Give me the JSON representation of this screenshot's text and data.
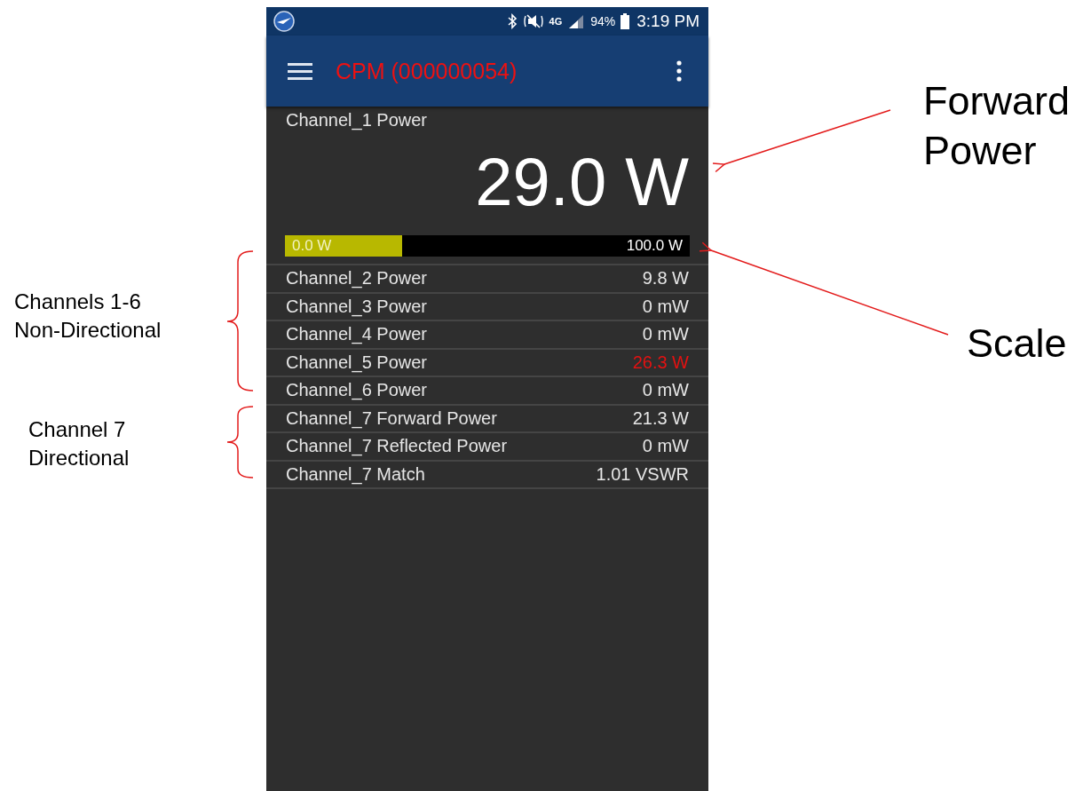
{
  "status_bar": {
    "network": "4G",
    "battery": "94%",
    "time": "3:19 PM"
  },
  "app_bar": {
    "title": "CPM (000000054)"
  },
  "primary": {
    "label": "Channel_1 Power",
    "value": "29.0 W",
    "scale": {
      "min": "0.0 W",
      "max": "100.0 W",
      "level": 0.29
    }
  },
  "rows": [
    {
      "label": "Channel_2 Power",
      "value": "9.8 W",
      "alert": false
    },
    {
      "label": "Channel_3 Power",
      "value": "0 mW",
      "alert": false
    },
    {
      "label": "Channel_4 Power",
      "value": "0 mW",
      "alert": false
    },
    {
      "label": "Channel_5 Power",
      "value": "26.3 W",
      "alert": true
    },
    {
      "label": "Channel_6 Power",
      "value": "0 mW",
      "alert": false
    },
    {
      "label": "Channel_7 Forward Power",
      "value": "21.3 W",
      "alert": false
    },
    {
      "label": "Channel_7 Reflected Power",
      "value": "0 mW",
      "alert": false
    },
    {
      "label": "Channel_7 Match",
      "value": "1.01 VSWR",
      "alert": false
    }
  ],
  "annotations": {
    "forward_power": "Forward\nPower",
    "scale": "Scale",
    "channels_1_6": "Channels 1-6\nNon-Directional",
    "channel_7": "Channel 7\nDirectional"
  }
}
